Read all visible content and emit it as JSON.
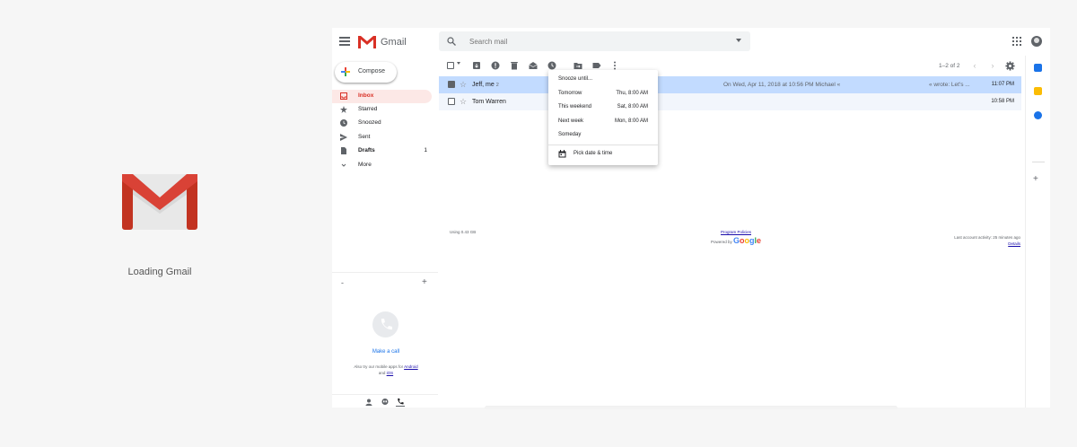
{
  "loading": {
    "text": "Loading Gmail"
  },
  "header": {
    "app_name": "Gmail",
    "search_placeholder": "Search mail"
  },
  "compose": {
    "label": "Compose"
  },
  "nav": [
    {
      "label": "Inbox",
      "icon": "inbox-icon",
      "active": true,
      "count": ""
    },
    {
      "label": "Starred",
      "icon": "star-icon",
      "active": false,
      "count": ""
    },
    {
      "label": "Snoozed",
      "icon": "clock-icon",
      "active": false,
      "count": ""
    },
    {
      "label": "Sent",
      "icon": "send-icon",
      "active": false,
      "count": ""
    },
    {
      "label": "Drafts",
      "icon": "draft-icon",
      "active": false,
      "count": "1"
    },
    {
      "label": "More",
      "icon": "chevron-down-icon",
      "active": false,
      "count": ""
    }
  ],
  "hangouts": {
    "call_label": "Make a call",
    "mobile_prefix": "Also try our mobile apps for",
    "android": "Android",
    "and": "and",
    "ios": "iOS"
  },
  "toolbar": {
    "page_info": "1–2 of 2"
  },
  "emails": [
    {
      "sender": "Jeff, me",
      "count": "2",
      "preview_left": "On Wed, Apr 11, 2018 at 10:56 PM Michael «",
      "preview_right": "« wrote: Let's ...",
      "time": "11:07 PM",
      "selected": true
    },
    {
      "sender": "Tom Warren",
      "count": "",
      "preview_left": "",
      "preview_right": "",
      "time": "10:58 PM",
      "selected": false
    }
  ],
  "snooze_menu": {
    "title": "Snooze until...",
    "items": [
      {
        "label": "Tomorrow",
        "time": "Thu, 8:00 AM"
      },
      {
        "label": "This weekend",
        "time": "Sat, 8:00 AM"
      },
      {
        "label": "Next week",
        "time": "Mon, 8:00 AM"
      },
      {
        "label": "Someday",
        "time": ""
      }
    ],
    "pick_label": "Pick date & time"
  },
  "footer": {
    "storage": "Using 0.43 GB",
    "policies": "Program Policies",
    "powered_by": "Powered by",
    "google": "Google",
    "last_activity": "Last account activity: 25 minutes ago",
    "details": "Details"
  },
  "colors": {
    "accent": "#d93025",
    "selected_row": "#c2dbff",
    "link": "#1a73e8"
  }
}
